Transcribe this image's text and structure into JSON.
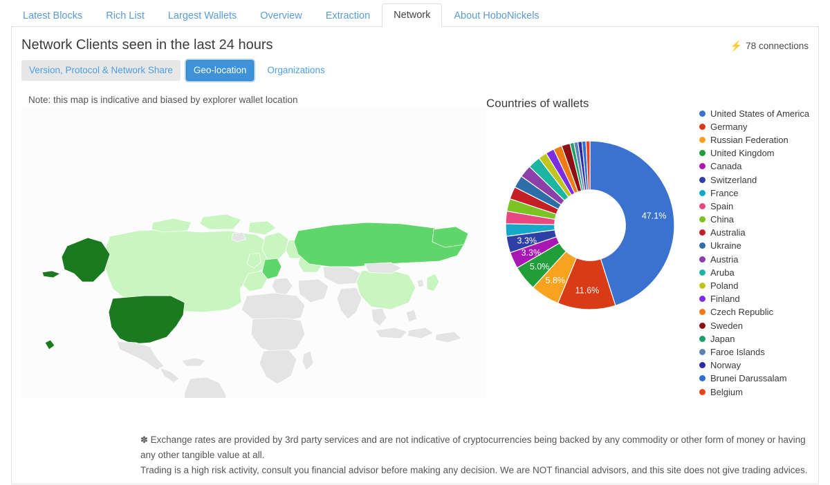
{
  "nav": {
    "tabs": [
      {
        "label": "Latest Blocks",
        "active": false
      },
      {
        "label": "Rich List",
        "active": false
      },
      {
        "label": "Largest Wallets",
        "active": false
      },
      {
        "label": "Overview",
        "active": false
      },
      {
        "label": "Extraction",
        "active": false
      },
      {
        "label": "Network",
        "active": true
      },
      {
        "label": "About HoboNickels",
        "active": false
      }
    ]
  },
  "header": {
    "title": "Network Clients seen in the last 24 hours",
    "connections": "78 connections",
    "bolt_icon": "lightning-bolt-icon"
  },
  "subtabs": [
    {
      "label": "Version, Protocol & Network Share",
      "state": "muted"
    },
    {
      "label": "Geo-location",
      "state": "active"
    },
    {
      "label": "Organizations",
      "state": "plain"
    }
  ],
  "map": {
    "note": "Note: this map is indicative and biased by explorer wallet location",
    "colors": {
      "high": "#1a7a1f",
      "mid": "#5fd66a",
      "low": "#c8f5c0",
      "none": "#e4e4e4",
      "background": "#fcfcfc"
    }
  },
  "chart_data": {
    "type": "pie",
    "title": "Countries of wallets",
    "legend_position": "right",
    "hole": 0.42,
    "categories": [
      "United States of America",
      "Germany",
      "Russian Federation",
      "United Kingdom",
      "Canada",
      "Switzerland",
      "France",
      "Spain",
      "China",
      "Australia",
      "Ukraine",
      "Austria",
      "Aruba",
      "Poland",
      "Finland",
      "Czech Republic",
      "Sweden",
      "Japan",
      "Faroe Islands",
      "Norway",
      "Brunei Darussalam",
      "Belgium"
    ],
    "values": [
      47.1,
      11.6,
      5.8,
      5.0,
      3.3,
      3.3,
      2.5,
      2.5,
      2.5,
      2.5,
      2.5,
      2.5,
      2.5,
      1.7,
      1.7,
      1.7,
      1.7,
      0.8,
      0.8,
      0.8,
      0.8,
      0.8
    ],
    "colors": [
      "#3b72d0",
      "#d93b17",
      "#f8a320",
      "#1f9e3a",
      "#a817b4",
      "#2e3fa8",
      "#17a8c9",
      "#e8487f",
      "#7bc222",
      "#c41f25",
      "#2d6ea8",
      "#8b3fa8",
      "#1bb5a0",
      "#c0c41f",
      "#7b2ee0",
      "#ef7b17",
      "#8c0f13",
      "#1f9e6e",
      "#5d82b5",
      "#2b2ba8",
      "#2e6fd6",
      "#e8441c"
    ],
    "slice_labels": [
      {
        "category": "United States of America",
        "text": "47.1%"
      },
      {
        "category": "Germany",
        "text": "11.6%"
      },
      {
        "category": "Russian Federation",
        "text": "5.8%"
      },
      {
        "category": "United Kingdom",
        "text": "5.0%"
      },
      {
        "category": "Canada",
        "text": "3.3%"
      },
      {
        "category": "Switzerland",
        "text": "3.3%"
      }
    ]
  },
  "footer": {
    "star_icon": "asterisk-icon",
    "line1": "Exchange rates are provided by 3rd party services and are not indicative of cryptocurrencies being backed by any commodity or other form of money or having any other tangible value at all.",
    "line2": "Trading is a high risk activity, consult you financial advisor before making any decision. We are NOT financial advisors, and this site does not give trading advices."
  }
}
